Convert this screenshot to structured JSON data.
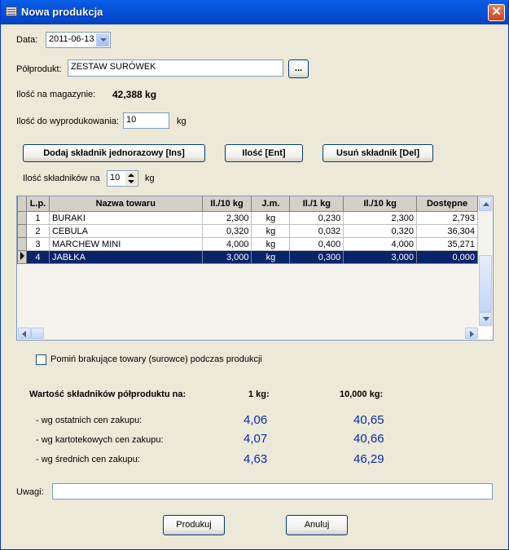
{
  "window": {
    "title": "Nowa produkcja",
    "close": "✕"
  },
  "form": {
    "date_label": "Data:",
    "date_value": "2011-06-13",
    "product_label": "Półprodukt:",
    "product_value": "ZESTAW SURÓWEK",
    "browse_label": "...",
    "stock_label": "Ilość na magazynie:",
    "stock_value": "42,388 kg",
    "produce_label": "Ilość do wyprodukowania:",
    "produce_value": "10",
    "produce_unit": "kg"
  },
  "buttons": {
    "add_once": "Dodaj składnik jednorazowy [Ins]",
    "quantity": "Ilość [Ent]",
    "remove": "Usuń składnik [Del]",
    "produce": "Produkuj",
    "cancel": "Anuluj"
  },
  "per": {
    "label": "Ilość składników na",
    "value": "10",
    "unit": "kg"
  },
  "table": {
    "columns": [
      "L.p.",
      "Nazwa towaru",
      "Il./10 kg",
      "J.m.",
      "Il./1 kg",
      "Il./10 kg",
      "Dostępne"
    ],
    "rows": [
      [
        "1",
        "BURAKI",
        "2,300",
        "kg",
        "0,230",
        "2,300",
        "2,793"
      ],
      [
        "2",
        "CEBULA",
        "0,320",
        "kg",
        "0,032",
        "0,320",
        "36,304"
      ],
      [
        "3",
        "MARCHEW MINI",
        "4,000",
        "kg",
        "0,400",
        "4,000",
        "35,271"
      ],
      [
        "4",
        "JABŁKA",
        "3,000",
        "kg",
        "0,300",
        "3,000",
        "0,000"
      ]
    ],
    "selected_row": 3
  },
  "skip_label": "Pomiń brakujące towary (surowce) podczas produkcji",
  "values": {
    "header": "Wartość składników półproduktu na:",
    "col1": "1 kg:",
    "col2": "10,000 kg:",
    "rows": [
      {
        "label": "- wg ostatnich cen zakupu:",
        "v1": "4,06",
        "v2": "40,65"
      },
      {
        "label": "- wg kartotekowych cen zakupu:",
        "v1": "4,07",
        "v2": "40,66"
      },
      {
        "label": "- wg średnich cen zakupu:",
        "v1": "4,63",
        "v2": "46,29"
      }
    ]
  },
  "notes": {
    "label": "Uwagi:",
    "value": ""
  }
}
